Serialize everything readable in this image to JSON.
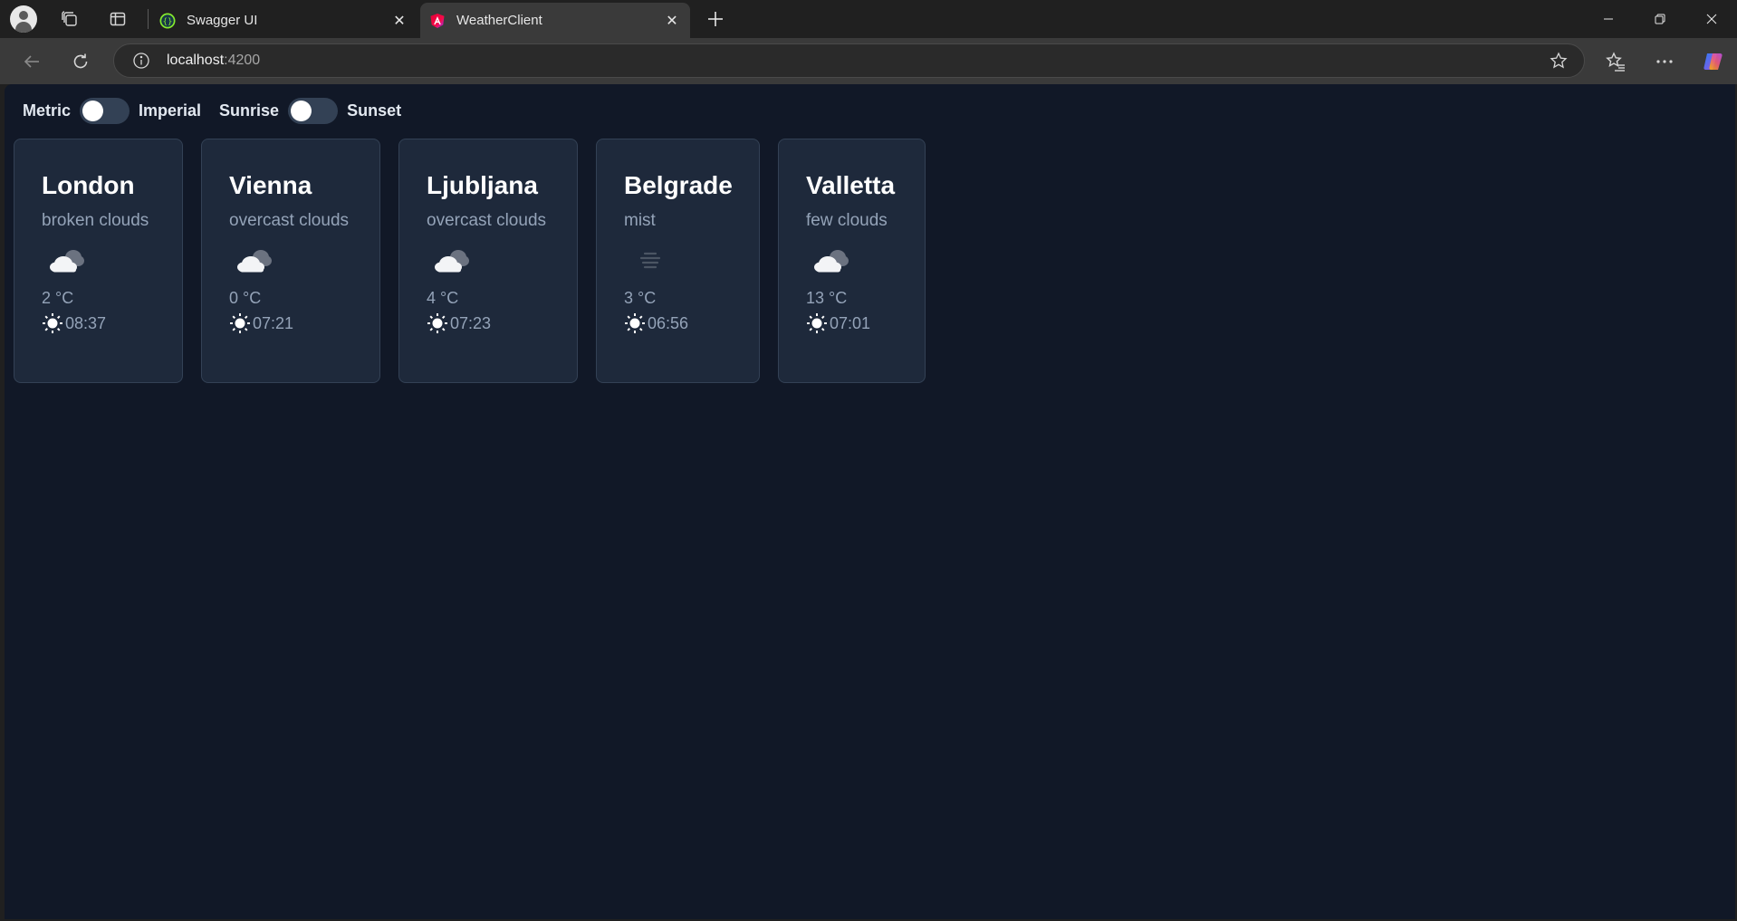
{
  "browser": {
    "tabs": [
      {
        "title": "Swagger UI",
        "active": false
      },
      {
        "title": "WeatherClient",
        "active": true
      }
    ],
    "url_host": "localhost",
    "url_port": ":4200"
  },
  "toggles": {
    "units_left": "Metric",
    "units_right": "Imperial",
    "sun_left": "Sunrise",
    "sun_right": "Sunset"
  },
  "cards": [
    {
      "city": "London",
      "description": "broken clouds",
      "icon": "broken-clouds-icon",
      "temp": "2 °C",
      "time": "08:37"
    },
    {
      "city": "Vienna",
      "description": "overcast clouds",
      "icon": "overcast-clouds-icon",
      "temp": "0 °C",
      "time": "07:21"
    },
    {
      "city": "Ljubljana",
      "description": "overcast clouds",
      "icon": "overcast-clouds-icon",
      "temp": "4 °C",
      "time": "07:23"
    },
    {
      "city": "Belgrade",
      "description": "mist",
      "icon": "mist-icon",
      "temp": "3 °C",
      "time": "06:56"
    },
    {
      "city": "Valletta",
      "description": "few clouds",
      "icon": "few-clouds-icon",
      "temp": "13 °C",
      "time": "07:01"
    }
  ],
  "colors": {
    "page_bg": "#111827",
    "card_bg": "#1e293b",
    "card_border": "#334155",
    "muted_text": "#94a3b8"
  }
}
